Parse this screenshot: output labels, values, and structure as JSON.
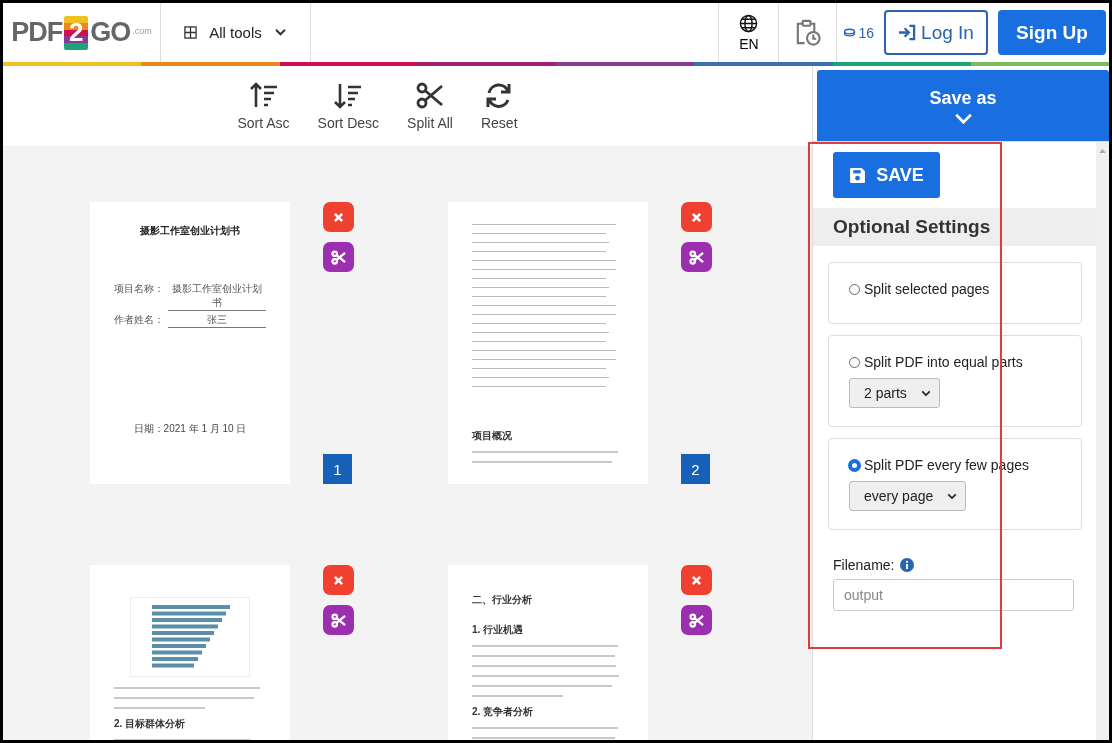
{
  "header": {
    "logo": {
      "left": "PDF",
      "badge": "2",
      "right": "GO",
      "domain": ".com"
    },
    "all_tools": "All tools",
    "language": "EN",
    "credits": "16",
    "login": "Log In",
    "signup": "Sign Up"
  },
  "toolbar": [
    {
      "kind": "sort-asc",
      "label": "Sort Asc"
    },
    {
      "kind": "sort-desc",
      "label": "Sort Desc"
    },
    {
      "kind": "split",
      "label": "Split All"
    },
    {
      "kind": "reset",
      "label": "Reset"
    }
  ],
  "pages": [
    {
      "kind": "cover",
      "number": "1",
      "title": "摄影工作室创业计划书",
      "fields": [
        {
          "label": "项目名称：",
          "value": "摄影工作室创业计划书"
        },
        {
          "label": "作者姓名：",
          "value": "张三"
        }
      ],
      "date": "日期：2021 年 1 月 10 日"
    },
    {
      "kind": "toc",
      "number": "2",
      "headings": [
        "项目概况"
      ]
    },
    {
      "kind": "chart",
      "headings": [
        "2. 目标群体分析"
      ]
    },
    {
      "kind": "text",
      "headings": [
        "二、行业分析",
        "1. 行业机遇",
        "2. 竞争者分析"
      ]
    }
  ],
  "sidebar": {
    "save_as": "Save as",
    "save": "SAVE",
    "section": "Optional Settings",
    "options": [
      {
        "label": "Split selected pages",
        "selected": false
      },
      {
        "label": "Split PDF into equal parts",
        "selected": false,
        "dropdown": "2 parts"
      },
      {
        "label": "Split PDF every few pages",
        "selected": true,
        "dropdown": "every page"
      }
    ],
    "filename": {
      "label": "Filename:",
      "placeholder": "output"
    }
  }
}
